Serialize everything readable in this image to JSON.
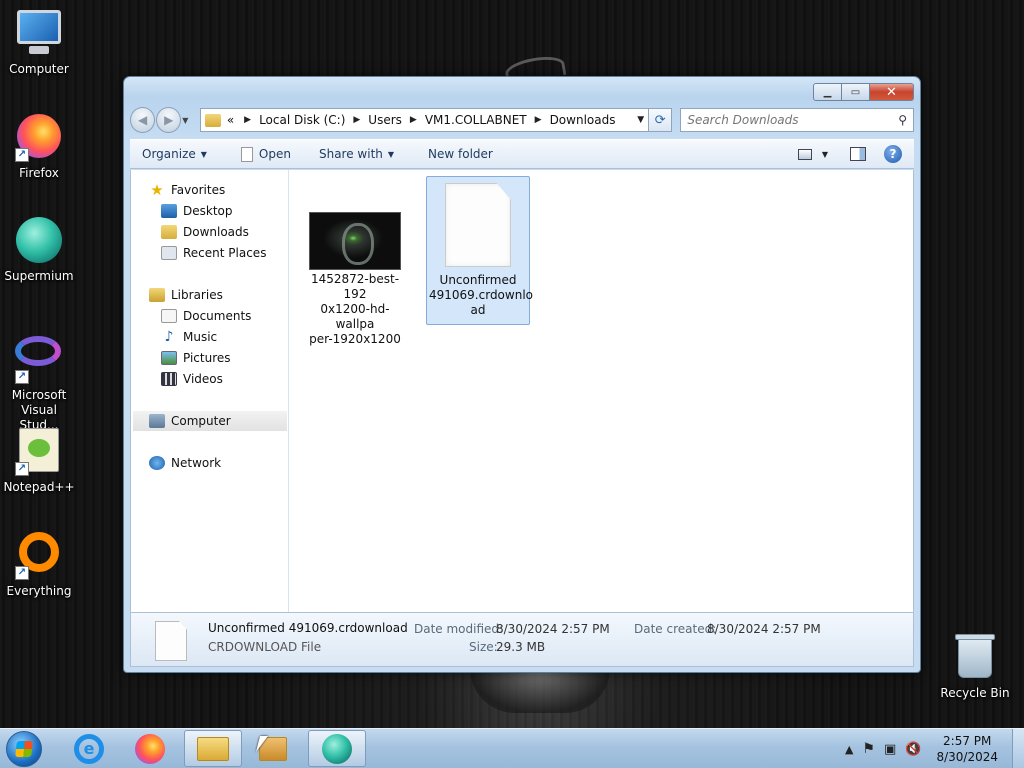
{
  "desktop": {
    "icons": [
      {
        "label": "Computer",
        "icon": "computer-icon"
      },
      {
        "label": "Firefox",
        "icon": "firefox-icon"
      },
      {
        "label": "Supermium",
        "icon": "supermium-icon"
      },
      {
        "label": "Microsoft Visual Stud...",
        "icon": "visual-studio-icon"
      },
      {
        "label": "Notepad++",
        "icon": "notepadplusplus-icon"
      },
      {
        "label": "Everything",
        "icon": "everything-icon"
      },
      {
        "label": "Recycle Bin",
        "icon": "recycle-bin-icon"
      }
    ]
  },
  "explorer": {
    "controls": {
      "minimize": "▁",
      "maximize": "▭",
      "close": "✕"
    },
    "breadcrumb": {
      "overflow": "«",
      "items": [
        "Local Disk (C:)",
        "Users",
        "VM1.COLLABNET",
        "Downloads"
      ]
    },
    "search": {
      "placeholder": "Search Downloads"
    },
    "toolbar": {
      "organize": "Organize",
      "open": "Open",
      "share_with": "Share with",
      "new_folder": "New folder"
    },
    "nav_pane": {
      "favorites": {
        "label": "Favorites",
        "items": [
          "Desktop",
          "Downloads",
          "Recent Places"
        ]
      },
      "libraries": {
        "label": "Libraries",
        "items": [
          "Documents",
          "Music",
          "Pictures",
          "Videos"
        ]
      },
      "computer": "Computer",
      "network": "Network"
    },
    "files": [
      {
        "name": "1452872-best-1920x1200-hd-wallpaper-1920x1200",
        "lines": [
          "1452872-best-192",
          "0x1200-hd-wallpa",
          "per-1920x1200"
        ],
        "selected": false
      },
      {
        "name": "Unconfirmed 491069.crdownload",
        "lines": [
          "Unconfirmed",
          "491069.crdownlo",
          "ad"
        ],
        "selected": true
      }
    ],
    "details": {
      "name": "Unconfirmed 491069.crdownload",
      "type": "CRDOWNLOAD File",
      "date_modified_label": "Date modified:",
      "date_modified": "8/30/2024 2:57 PM",
      "date_created_label": "Date created:",
      "date_created": "8/30/2024 2:57 PM",
      "size_label": "Size:",
      "size": "29.3 MB"
    }
  },
  "taskbar": {
    "ie_glyph": "e",
    "clock": {
      "time": "2:57 PM",
      "date": "8/30/2024"
    }
  }
}
